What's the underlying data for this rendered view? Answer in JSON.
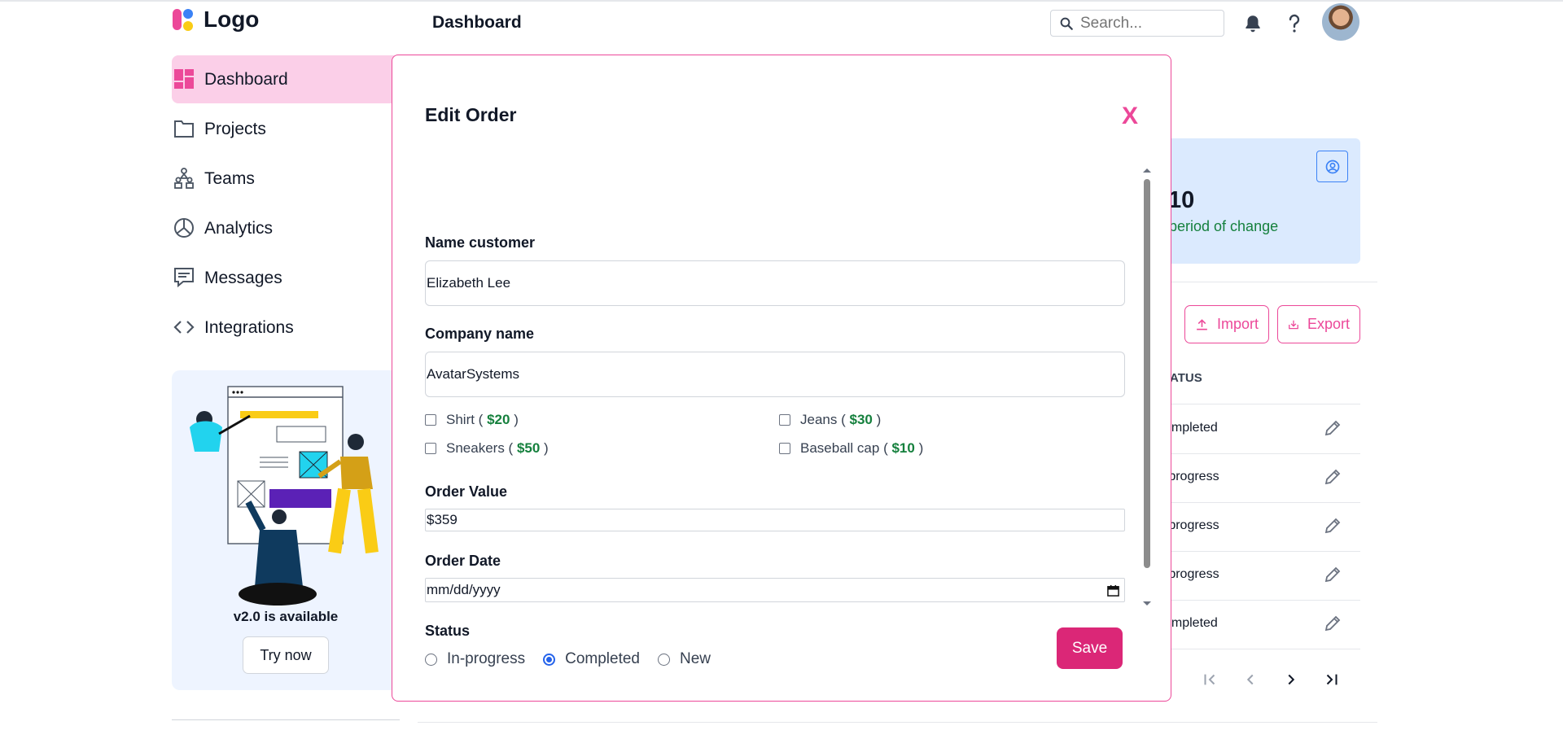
{
  "header": {
    "logo_text": "Logo",
    "page_title": "Dashboard",
    "search_placeholder": "Search...",
    "icons": [
      "bell-icon",
      "help-icon"
    ]
  },
  "sidebar": {
    "items": [
      {
        "label": "Dashboard",
        "icon": "dashboard-icon",
        "active": true
      },
      {
        "label": "Projects",
        "icon": "folder-icon"
      },
      {
        "label": "Teams",
        "icon": "teams-icon"
      },
      {
        "label": "Analytics",
        "icon": "pie-chart-icon"
      },
      {
        "label": "Messages",
        "icon": "message-icon"
      },
      {
        "label": "Integrations",
        "icon": "code-icon"
      }
    ],
    "promo": {
      "text": "v2.0 is available",
      "button": "Try now"
    }
  },
  "background": {
    "stat_value": "10",
    "stat_sub": "period of change",
    "import_label": "Import",
    "export_label": "Export",
    "status_header": "ATUS",
    "rows": [
      {
        "status": "ompleted"
      },
      {
        "status": "-progress"
      },
      {
        "status": "-progress"
      },
      {
        "status": "-progress"
      },
      {
        "status": "ompleted"
      }
    ]
  },
  "modal": {
    "title": "Edit Order",
    "close_label": "X",
    "name_label": "Name customer",
    "name_value": "Elizabeth Lee",
    "company_label": "Company name",
    "company_value": "AvatarSystems",
    "products": [
      {
        "name": "Shirt (",
        "price": "$20",
        "close": ")"
      },
      {
        "name": "Jeans (",
        "price": "$30",
        "close": ")"
      },
      {
        "name": "Sneakers (",
        "price": "$50",
        "close": ")"
      },
      {
        "name": "Baseball cap (",
        "price": "$10",
        "close": ")"
      }
    ],
    "order_value_label": "Order Value",
    "order_value": "$359",
    "order_date_label": "Order Date",
    "order_date_placeholder": "mm/dd/yyyy",
    "status_label": "Status",
    "status_options": [
      "In-progress",
      "Completed",
      "New"
    ],
    "status_selected": "Completed",
    "save_label": "Save"
  },
  "colors": {
    "accent": "#db2777",
    "accent_light": "#fbcfe8",
    "price": "#15803d",
    "card": "#dbeafe"
  }
}
